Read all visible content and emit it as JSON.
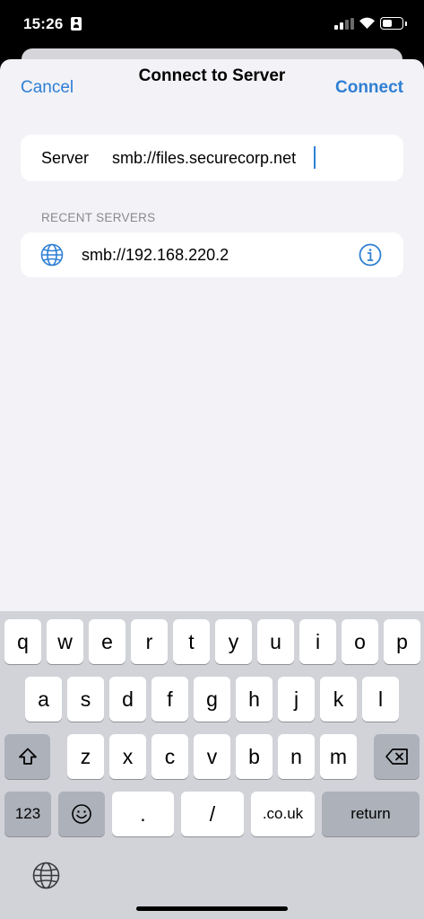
{
  "status_bar": {
    "time": "15:26",
    "battery_level": 0.55
  },
  "nav": {
    "title": "Connect to Server",
    "cancel_label": "Cancel",
    "connect_label": "Connect"
  },
  "server": {
    "label": "Server",
    "value": "smb://files.securecorp.net"
  },
  "recent": {
    "header": "RECENT SERVERS",
    "items": [
      "smb://192.168.220.2"
    ]
  },
  "keyboard": {
    "row1": [
      "q",
      "w",
      "e",
      "r",
      "t",
      "y",
      "u",
      "i",
      "o",
      "p"
    ],
    "row2": [
      "a",
      "s",
      "d",
      "f",
      "g",
      "h",
      "j",
      "k",
      "l"
    ],
    "row3": [
      "z",
      "x",
      "c",
      "v",
      "b",
      "n",
      "m"
    ],
    "numbers_label": "123",
    "dot_label": ".",
    "slash_label": "/",
    "couk_label": ".co.uk",
    "return_label": "return"
  },
  "colors": {
    "accent": "#2f7fd3",
    "sheet_background": "#f2f2f7",
    "keyboard_background": "#d1d3d9"
  }
}
